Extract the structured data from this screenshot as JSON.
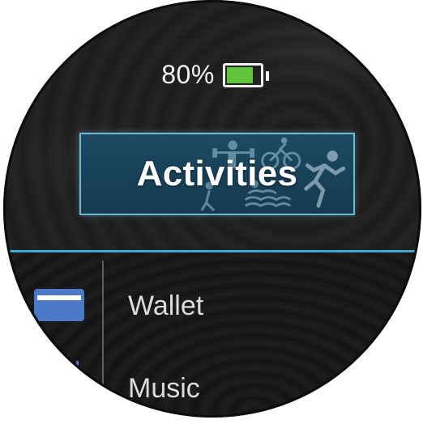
{
  "status": {
    "battery_percent_text": "80%",
    "battery_level": 0.8,
    "battery_color": "#5fc33b"
  },
  "activities_button": {
    "label": "Activities",
    "background_icons": [
      "weightlifting-icon",
      "cycling-icon",
      "running-icon",
      "hiking-icon",
      "swimming-icon"
    ],
    "accent": "#6fb9d6"
  },
  "divider_color": "#44a6d2",
  "menu": {
    "items": [
      {
        "label": "Wallet",
        "icon": "wallet-card-icon",
        "icon_color": "#4a79c8"
      },
      {
        "label": "Music",
        "icon": "music-icon",
        "icon_color": "#4a79c8"
      }
    ]
  }
}
